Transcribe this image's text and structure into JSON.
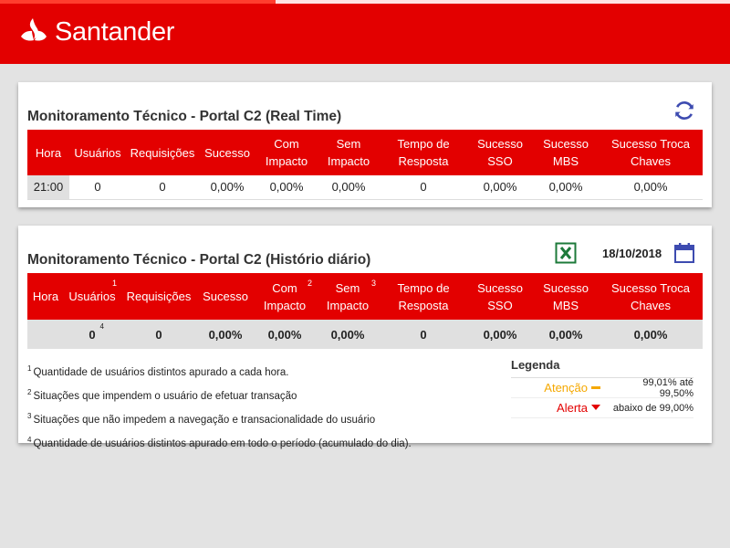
{
  "header": {
    "brand": "Santander"
  },
  "realtime": {
    "title": "Monitoramento Técnico - Portal C2 (Real Time)",
    "columns": [
      "Hora",
      "Usuários",
      "Requisições",
      "Sucesso",
      "Com Impacto",
      "Sem Impacto",
      "Tempo de Resposta",
      "Sucesso SSO",
      "Sucesso MBS",
      "Sucesso Troca Chaves"
    ],
    "row": [
      "21:00",
      "0",
      "0",
      "0,00%",
      "0,00%",
      "0,00%",
      "0",
      "0,00%",
      "0,00%",
      "0,00%"
    ]
  },
  "history": {
    "title": "Monitoramento Técnico - Portal C2 (Histório diário)",
    "date": "18/10/2018",
    "columns": [
      "Hora",
      "Usuários",
      "Requisições",
      "Sucesso",
      "Com Impacto",
      "Sem Impacto",
      "Tempo de Resposta",
      "Sucesso SSO",
      "Sucesso MBS",
      "Sucesso Troca Chaves"
    ],
    "superscripts": {
      "usuarios": "1",
      "com_impacto": "2",
      "sem_impacto": "3",
      "total_usuarios": "4"
    },
    "row": [
      "",
      "0",
      "0",
      "0,00%",
      "0,00%",
      "0,00%",
      "0",
      "0,00%",
      "0,00%",
      "0,00%"
    ]
  },
  "footnotes": [
    {
      "num": "1",
      "text": "Quantidade de usuários distintos apurado a cada hora."
    },
    {
      "num": "2",
      "text": "Situações que impendem o usuário de efetuar transação"
    },
    {
      "num": "3",
      "text": "Situações que não impedem a navegação e transacionalidade do usuário"
    },
    {
      "num": "4",
      "text": "Quantidade de usuários distintos apurado em todo o período (acumulado do dia)."
    }
  ],
  "legend": {
    "title": "Legenda",
    "attention": {
      "label": "Atenção",
      "desc": "99,01% até 99,50%",
      "color": "#f5a800"
    },
    "alert": {
      "label": "Alerta",
      "desc": "abaixo de 99,00%",
      "color": "#e30000"
    }
  },
  "colors": {
    "brand": "#e30000",
    "icon_blue": "#3d4bb0",
    "excel_green": "#1d7a3a"
  }
}
